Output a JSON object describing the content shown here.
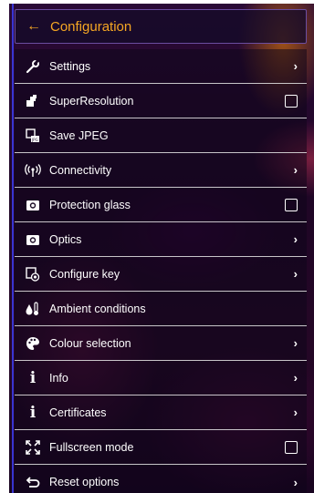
{
  "header": {
    "title": "Configuration"
  },
  "menu": {
    "items": [
      {
        "label": "Settings",
        "control": "chevron",
        "icon": "wrench-icon"
      },
      {
        "label": "SuperResolution",
        "control": "checkbox",
        "checked": false,
        "icon": "superresolution-icon"
      },
      {
        "label": "Save JPEG",
        "control": "none",
        "icon": "save-jpeg-icon"
      },
      {
        "label": "Connectivity",
        "control": "chevron",
        "icon": "wireless-icon"
      },
      {
        "label": "Protection glass",
        "control": "checkbox",
        "checked": false,
        "icon": "camera-icon"
      },
      {
        "label": "Optics",
        "control": "chevron",
        "icon": "camera-icon"
      },
      {
        "label": "Configure key",
        "control": "chevron",
        "icon": "key-config-icon"
      },
      {
        "label": "Ambient conditions",
        "control": "none",
        "icon": "thermometer-drop-icon"
      },
      {
        "label": "Colour selection",
        "control": "chevron",
        "icon": "palette-icon"
      },
      {
        "label": "Info",
        "control": "chevron",
        "icon": "info-icon"
      },
      {
        "label": "Certificates",
        "control": "chevron",
        "icon": "info-icon"
      },
      {
        "label": "Fullscreen mode",
        "control": "checkbox",
        "checked": false,
        "icon": "fullscreen-icon"
      },
      {
        "label": "Reset options",
        "control": "chevron",
        "icon": "reset-icon"
      }
    ]
  },
  "colors": {
    "accent": "#f5a623",
    "text": "#ffffff",
    "header_border": "#6b4da0"
  }
}
